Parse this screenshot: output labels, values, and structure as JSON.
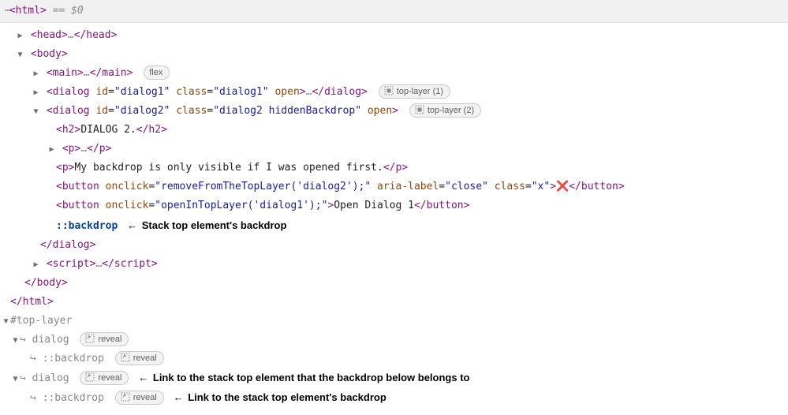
{
  "topbar": {
    "ell": "⋯",
    "open_tag": "<html>",
    "eq": " == ",
    "jsvar": "$0"
  },
  "rows": {
    "head": {
      "open": "<head>",
      "ell": "…",
      "close": "</head>"
    },
    "body_open": "<body>",
    "main": {
      "open": "<main>",
      "ell": "…",
      "close": "</main>",
      "badge": "flex"
    },
    "dialog1": {
      "tag_open": "<dialog ",
      "attr_id": "id",
      "val_id": "\"dialog1\"",
      "attr_class": "class",
      "val_class": "\"dialog1\"",
      "attr_open": "open",
      "tag_close_a": ">",
      "ell": "…",
      "close": "</dialog>",
      "badge": "top-layer (1)"
    },
    "dialog2": {
      "tag_open": "<dialog ",
      "attr_id": "id",
      "val_id": "\"dialog2\"",
      "attr_class": "class",
      "val_class": "\"dialog2 hiddenBackdrop\"",
      "attr_open": "open",
      "tag_close_a": ">",
      "badge": "top-layer (2)"
    },
    "h2": {
      "open": "<h2>",
      "text": "DIALOG 2.",
      "close": "</h2>"
    },
    "p_collapsed": {
      "open": "<p>",
      "ell": "…",
      "close": "</p>"
    },
    "p_text": {
      "open": "<p>",
      "text": "My backdrop is only visible if I was opened first.",
      "close": "</p>"
    },
    "btn_x": {
      "tag_open": "<button ",
      "attr_onclick": "onclick",
      "val_onclick": "\"removeFromTheTopLayer('dialog2');\"",
      "attr_aria": "aria-label",
      "val_aria": "\"close\"",
      "attr_class": "class",
      "val_class": "\"x\"",
      "tag_close_a": ">",
      "text": "❌",
      "close": "</button>"
    },
    "btn_open1": {
      "tag_open": "<button ",
      "attr_onclick": "onclick",
      "val_onclick": "\"openInTopLayer('dialog1');\"",
      "tag_close_a": ">",
      "text": "Open Dialog 1",
      "close": "</button>"
    },
    "backdrop_pseudo": "::backdrop",
    "backdrop_anno": "Stack top element's backdrop",
    "dialog2_close": "</dialog>",
    "script": {
      "open": "<script>",
      "ell": "…",
      "close": "</script>"
    },
    "body_close": "</body>",
    "html_close": "</html>"
  },
  "toplayer": {
    "header": "#top-layer",
    "hook": "↪",
    "dialog": "dialog",
    "backdrop": "::backdrop",
    "reveal": "reveal",
    "anno_dialog": "Link to the stack top element that the backdrop below belongs to",
    "anno_backdrop": "Link to the stack top element's backdrop"
  },
  "arrow_left": "←"
}
